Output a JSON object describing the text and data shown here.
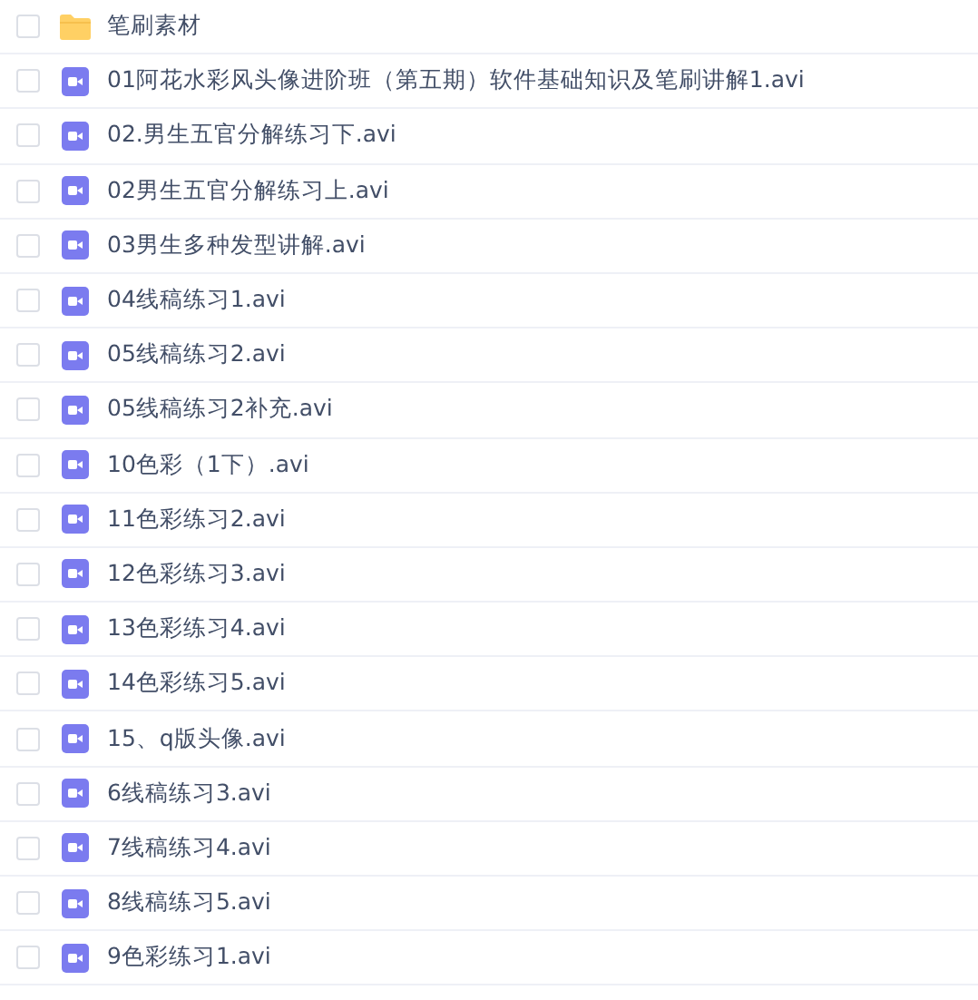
{
  "files": [
    {
      "name": "笔刷素材",
      "kind": "folder",
      "checked": false
    },
    {
      "name": "01阿花水彩风头像进阶班（第五期）软件基础知识及笔刷讲解1.avi",
      "kind": "video",
      "checked": false
    },
    {
      "name": "02.男生五官分解练习下.avi",
      "kind": "video",
      "checked": false
    },
    {
      "name": "02男生五官分解练习上.avi",
      "kind": "video",
      "checked": false
    },
    {
      "name": "03男生多种发型讲解.avi",
      "kind": "video",
      "checked": false
    },
    {
      "name": "04线稿练习1.avi",
      "kind": "video",
      "checked": false
    },
    {
      "name": "05线稿练习2.avi",
      "kind": "video",
      "checked": false
    },
    {
      "name": "05线稿练习2补充.avi",
      "kind": "video",
      "checked": false
    },
    {
      "name": "10色彩（1下）.avi",
      "kind": "video",
      "checked": false
    },
    {
      "name": "11色彩练习2.avi",
      "kind": "video",
      "checked": false
    },
    {
      "name": "12色彩练习3.avi",
      "kind": "video",
      "checked": false
    },
    {
      "name": "13色彩练习4.avi",
      "kind": "video",
      "checked": false
    },
    {
      "name": "14色彩练习5.avi",
      "kind": "video",
      "checked": false
    },
    {
      "name": "15、q版头像.avi",
      "kind": "video",
      "checked": false
    },
    {
      "name": "6线稿练习3.avi",
      "kind": "video",
      "checked": false
    },
    {
      "name": "7线稿练习4.avi",
      "kind": "video",
      "checked": false
    },
    {
      "name": "8线稿练习5.avi",
      "kind": "video",
      "checked": false
    },
    {
      "name": "9色彩练习1.avi",
      "kind": "video",
      "checked": false
    }
  ]
}
